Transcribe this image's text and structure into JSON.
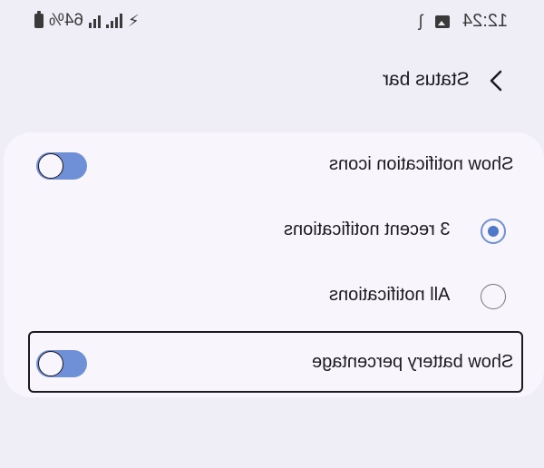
{
  "status_bar": {
    "time": "12:24",
    "battery": "64%"
  },
  "header": {
    "title": "Status bar"
  },
  "settings": {
    "show_notification_icons": {
      "label": "Show notification icons",
      "enabled": true
    },
    "options": [
      {
        "label": "3 recent notifications",
        "selected": true
      },
      {
        "label": "All notifications",
        "selected": false
      }
    ],
    "show_battery_percentage": {
      "label": "Show battery percentage",
      "enabled": true
    }
  },
  "colors": {
    "accent": "#6f8fd6",
    "background": "#efedf5",
    "card": "#f8f6fc"
  }
}
